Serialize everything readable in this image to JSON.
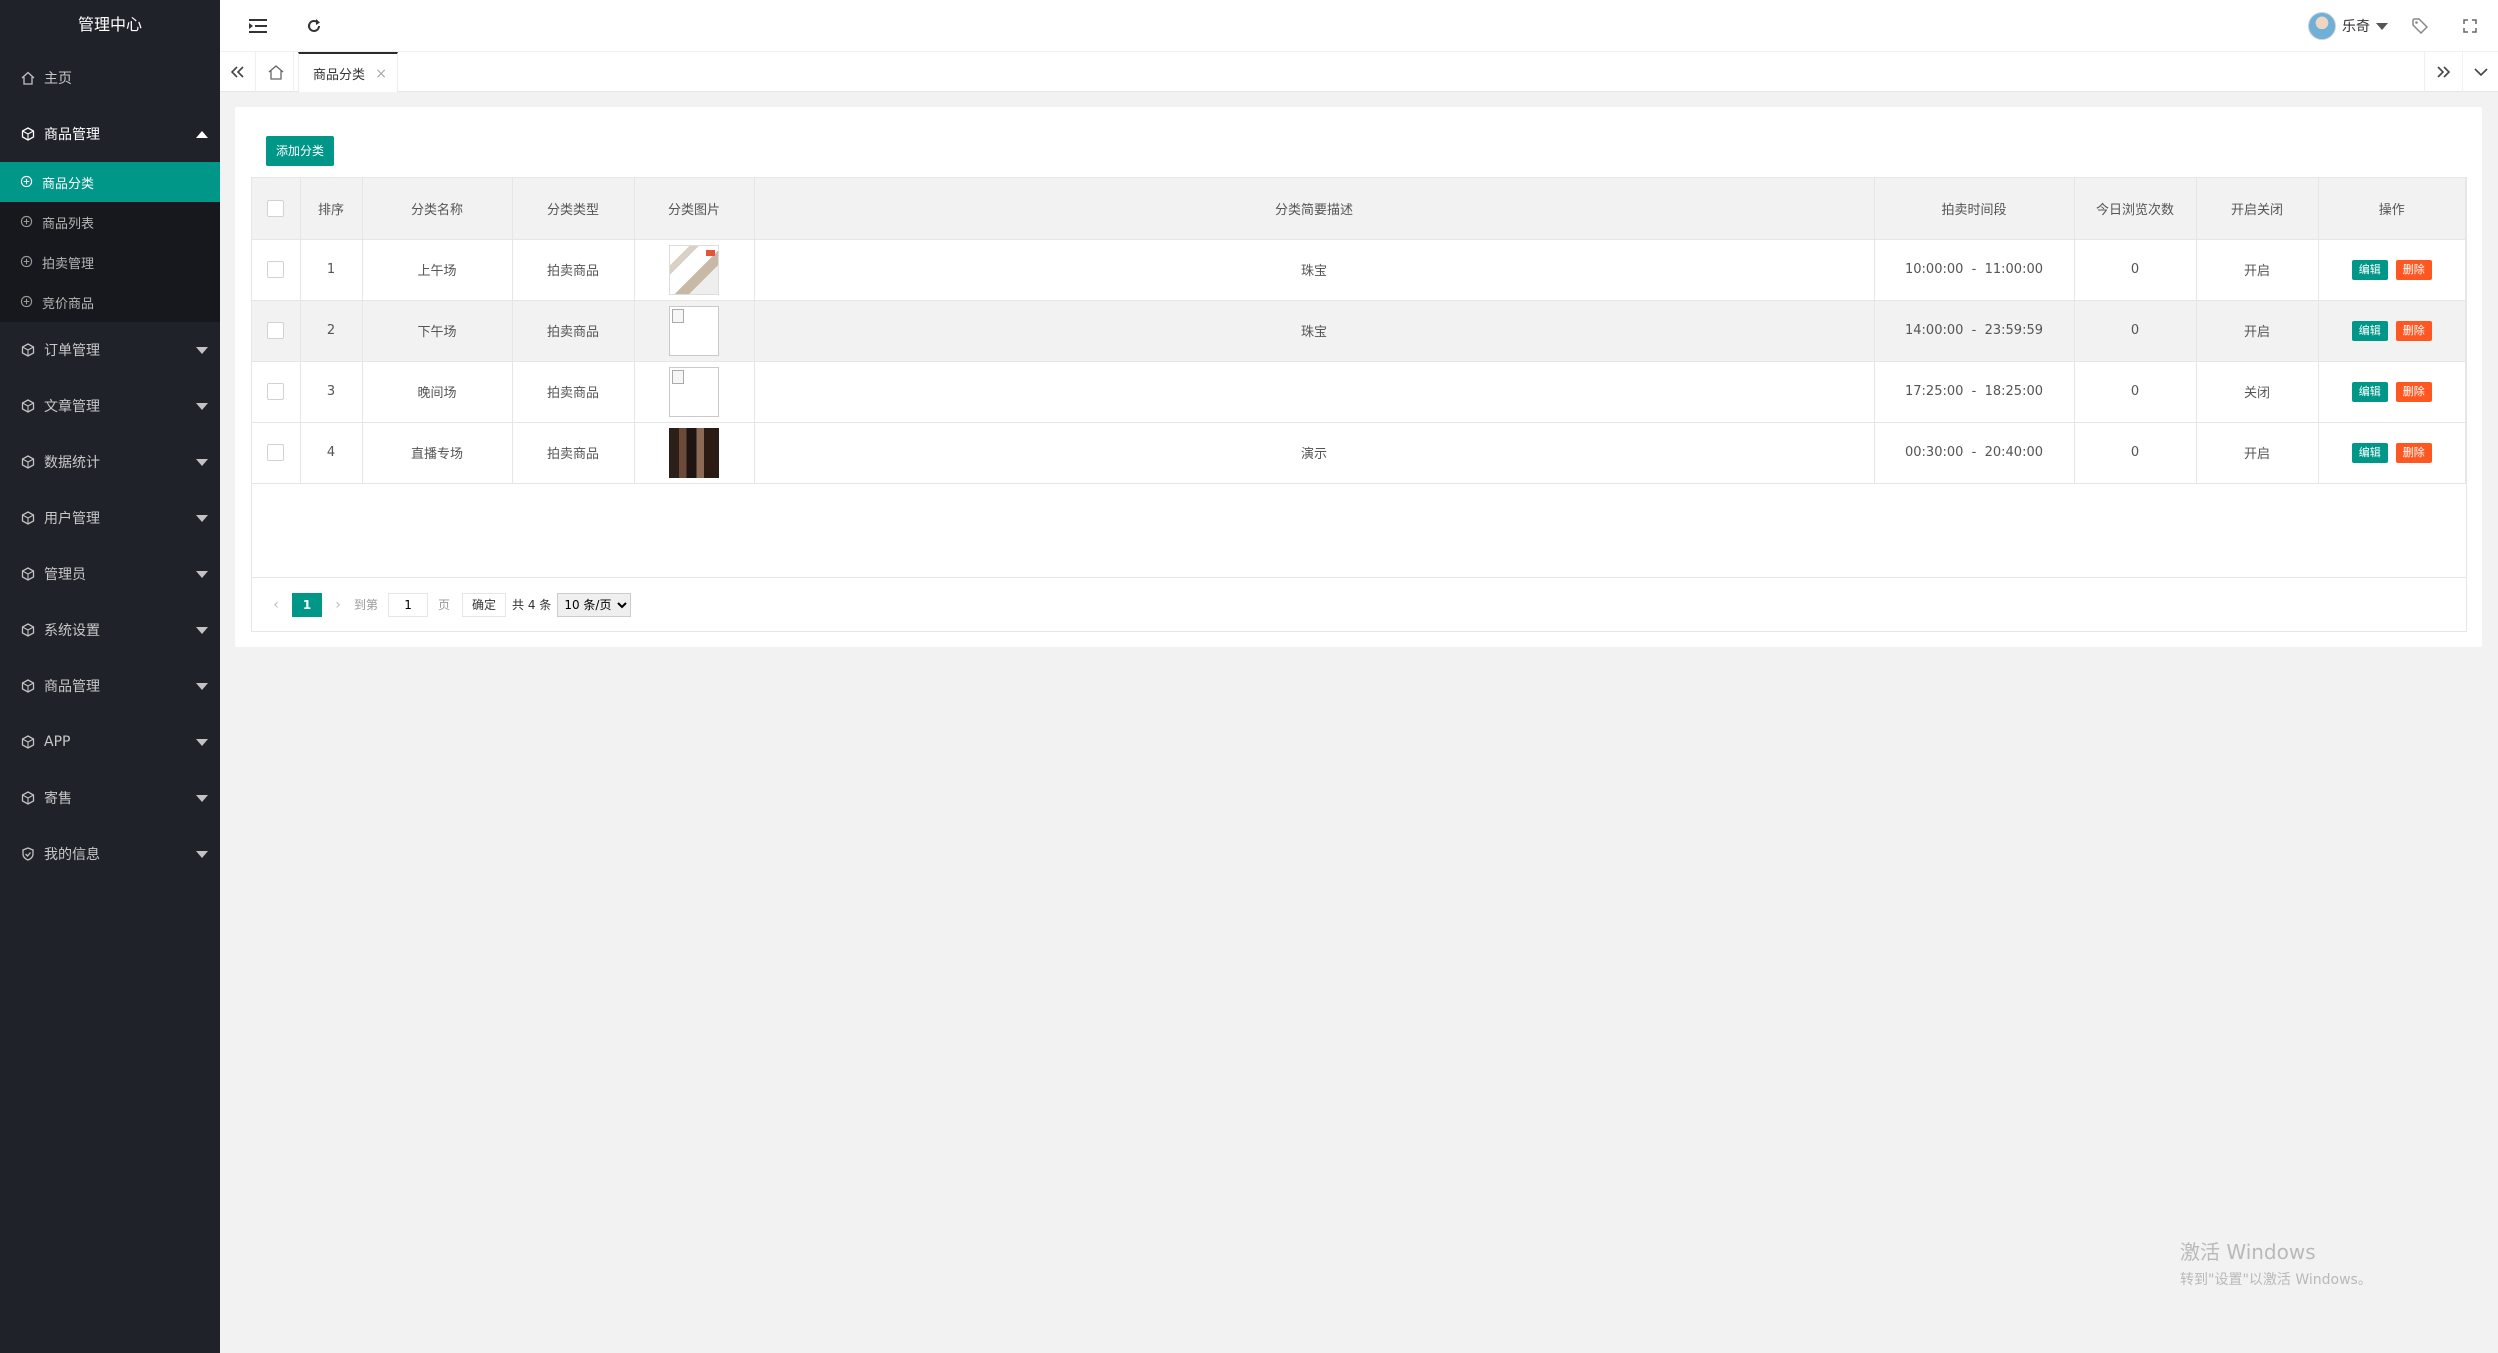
{
  "sidebar": {
    "title": "管理中心",
    "items": [
      {
        "label": "主页",
        "icon": "home-icon"
      },
      {
        "label": "商品管理",
        "icon": "cube-icon",
        "open": true,
        "children": [
          "商品分类",
          "商品列表",
          "拍卖管理",
          "竞价商品"
        ]
      },
      {
        "label": "订单管理",
        "icon": "cube-icon"
      },
      {
        "label": "文章管理",
        "icon": "cube-icon"
      },
      {
        "label": "数据统计",
        "icon": "cube-icon"
      },
      {
        "label": "用户管理",
        "icon": "cube-icon"
      },
      {
        "label": "管理员",
        "icon": "cube-icon"
      },
      {
        "label": "系统设置",
        "icon": "cube-icon"
      },
      {
        "label": "商品管理",
        "icon": "cube-icon"
      },
      {
        "label": "APP",
        "icon": "cube-icon"
      },
      {
        "label": "寄售",
        "icon": "cube-icon"
      },
      {
        "label": "我的信息",
        "icon": "shield-icon"
      }
    ]
  },
  "header": {
    "user_name": "乐奇"
  },
  "tabs": {
    "active": "商品分类"
  },
  "toolbar": {
    "add_label": "添加分类"
  },
  "table": {
    "columns": [
      "排序",
      "分类名称",
      "分类类型",
      "分类图片",
      "分类简要描述",
      "拍卖时间段",
      "今日浏览次数",
      "开启关闭",
      "操作"
    ],
    "rows": [
      {
        "sort": "1",
        "name": "上午场",
        "type": "拍卖商品",
        "image": "img1",
        "desc": "珠宝",
        "time": "10:00:00  -  11:00:00",
        "views": "0",
        "status": "开启"
      },
      {
        "sort": "2",
        "name": "下午场",
        "type": "拍卖商品",
        "image": "broken",
        "desc": "珠宝",
        "time": "14:00:00  -  23:59:59",
        "views": "0",
        "status": "开启"
      },
      {
        "sort": "3",
        "name": "晚间场",
        "type": "拍卖商品",
        "image": "broken",
        "desc": "",
        "time": "17:25:00  -  18:25:00",
        "views": "0",
        "status": "关闭"
      },
      {
        "sort": "4",
        "name": "直播专场",
        "type": "拍卖商品",
        "image": "img4",
        "desc": "演示",
        "time": "00:30:00  -  20:40:00",
        "views": "0",
        "status": "开启"
      }
    ],
    "edit_label": "编辑",
    "delete_label": "删除"
  },
  "pager": {
    "current": "1",
    "goto_label": "到第",
    "goto_value": "1",
    "page_unit": "页",
    "confirm_label": "确定",
    "total": "共 4 条",
    "page_size": "10 条/页"
  },
  "watermark": {
    "line1": "激活 Windows",
    "line2": "转到\"设置\"以激活 Windows。"
  },
  "colors": {
    "accent": "#009688",
    "danger": "#ff5722",
    "sidebar_bg": "#20222a"
  }
}
